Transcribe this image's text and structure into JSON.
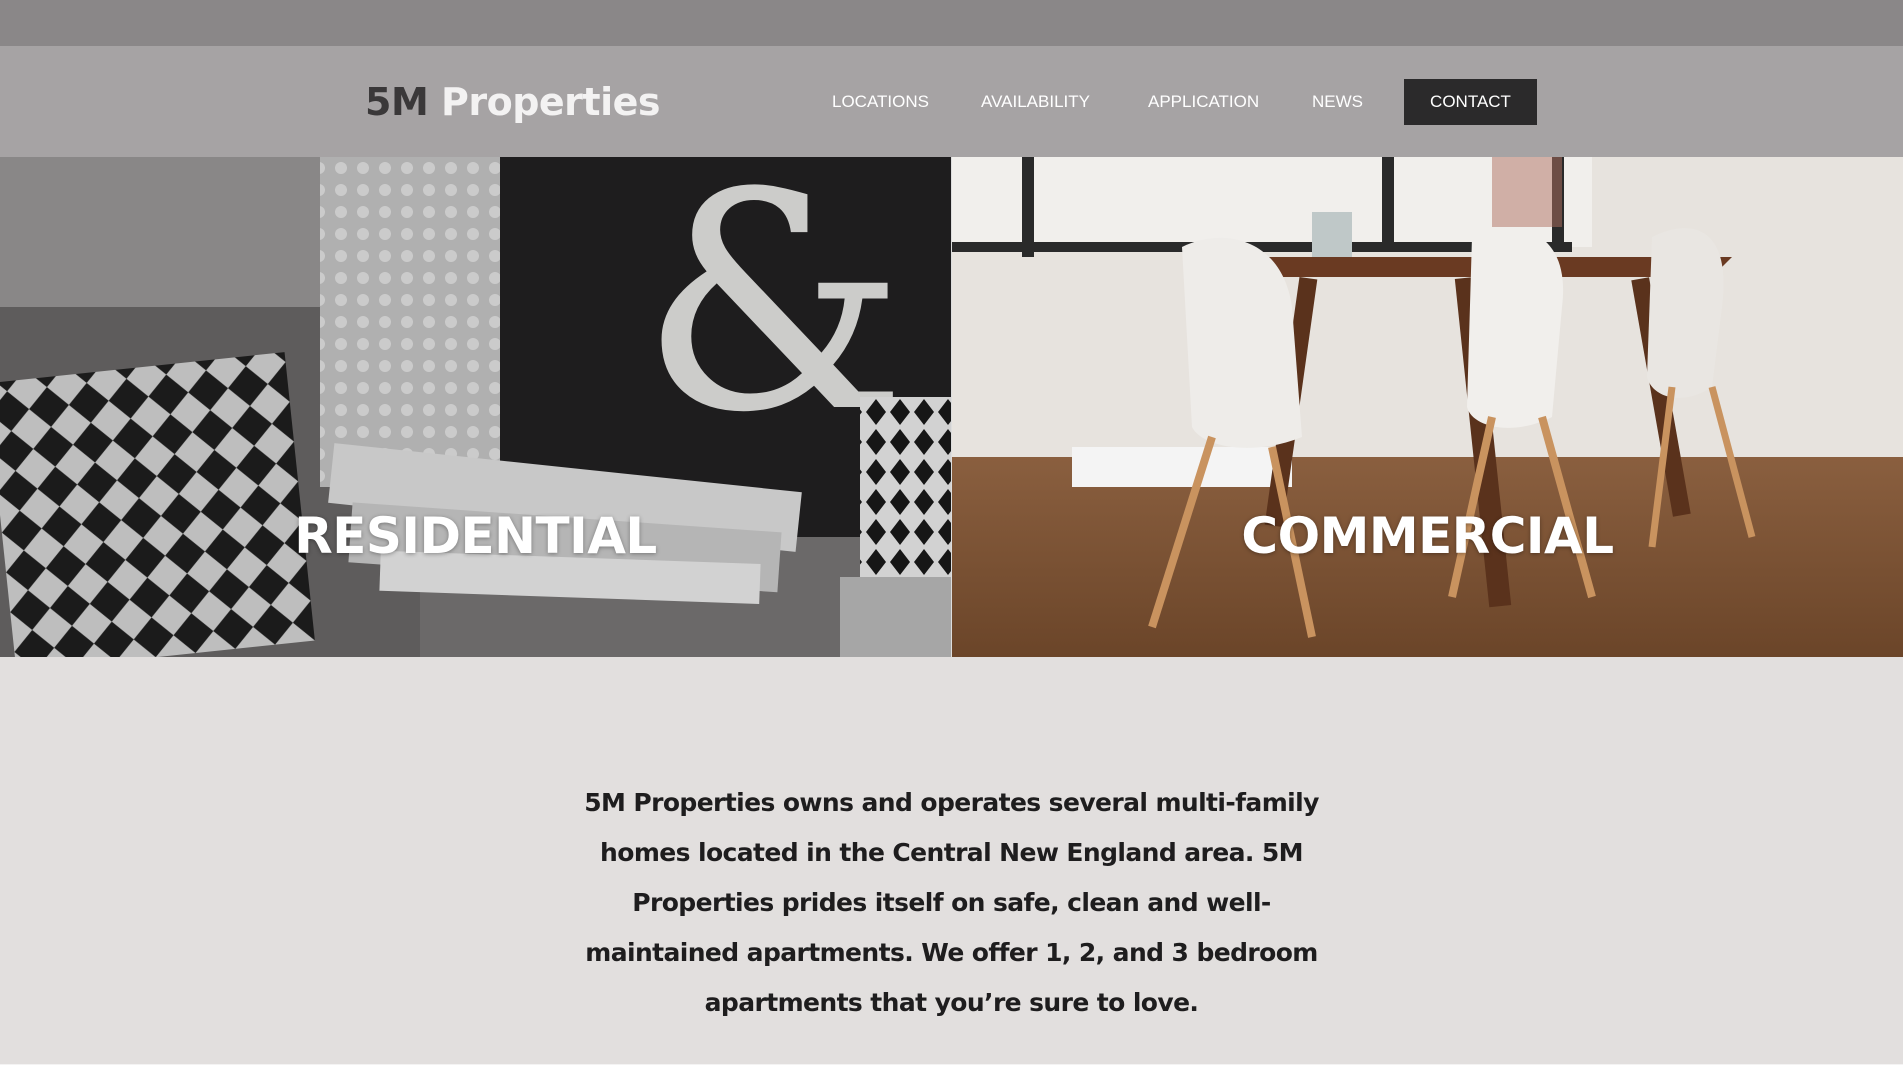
{
  "header": {
    "logo_part1": "5M",
    "logo_part2": "Properties",
    "nav": [
      {
        "label": "LOCATIONS"
      },
      {
        "label": "AVAILABILITY"
      },
      {
        "label": "APPLICATION"
      },
      {
        "label": "NEWS"
      },
      {
        "label": "CONTACT"
      }
    ]
  },
  "tiles": {
    "left_label": "RESIDENTIAL",
    "right_label": "COMMERCIAL"
  },
  "intro": {
    "text": "5M Properties owns and operates several multi-family homes located in the Central New England area. 5M Properties prides itself on safe, clean and well-maintained apartments. We offer 1, 2, and 3 bedroom apartments that you’re sure to love."
  },
  "colors": {
    "topbar": "#8a8788",
    "header": "#a6a3a4",
    "contact_bg": "#2b2a2b",
    "page_bg": "#e2dfde"
  }
}
